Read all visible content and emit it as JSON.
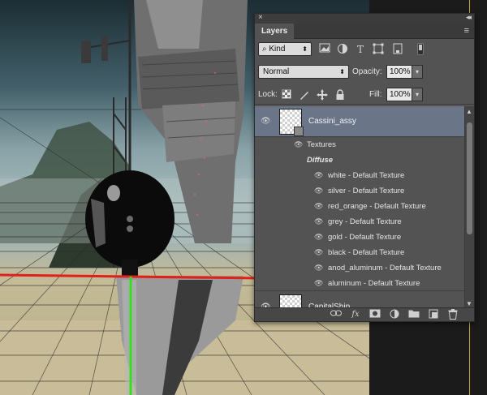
{
  "panel": {
    "close_glyph": "×",
    "collapse_glyph": "◂◂",
    "tab_label": "Layers",
    "menu_glyph": "≡"
  },
  "filter": {
    "kind_label": "Kind",
    "kind_icon": "⌕",
    "icons": [
      "image-filter-icon",
      "adjustment-filter-icon",
      "type-filter-icon",
      "shape-filter-icon",
      "smart-object-filter-icon"
    ],
    "type_glyph": "T"
  },
  "blend": {
    "mode": "Normal",
    "opacity_label": "Opacity:",
    "opacity_value": "100%",
    "fill_label": "Fill:",
    "fill_value": "100%"
  },
  "lock": {
    "label": "Lock:"
  },
  "layers": [
    {
      "name": "Cassini_assy",
      "selected": true,
      "textures_label": "Textures",
      "diffuse_label": "Diffuse",
      "textures": [
        "white - Default Texture",
        "silver - Default Texture",
        "red_orange - Default Texture",
        "grey - Default Texture",
        "gold - Default Texture",
        "black - Default Texture",
        "anod_aluminum - Default Texture",
        "aluminum - Default Texture"
      ]
    },
    {
      "name": "CapitalShip",
      "selected": false
    }
  ],
  "bottom_icons": [
    "link-layers-icon",
    "fx-icon",
    "add-mask-icon",
    "adjustment-layer-icon",
    "new-group-icon",
    "new-layer-icon",
    "trash-icon"
  ],
  "bottom_fx": "fx",
  "colors": {
    "red_axis": "#e0201a",
    "green_axis": "#33e01f",
    "selection": "#6a7688",
    "panel_bg": "#535353"
  }
}
